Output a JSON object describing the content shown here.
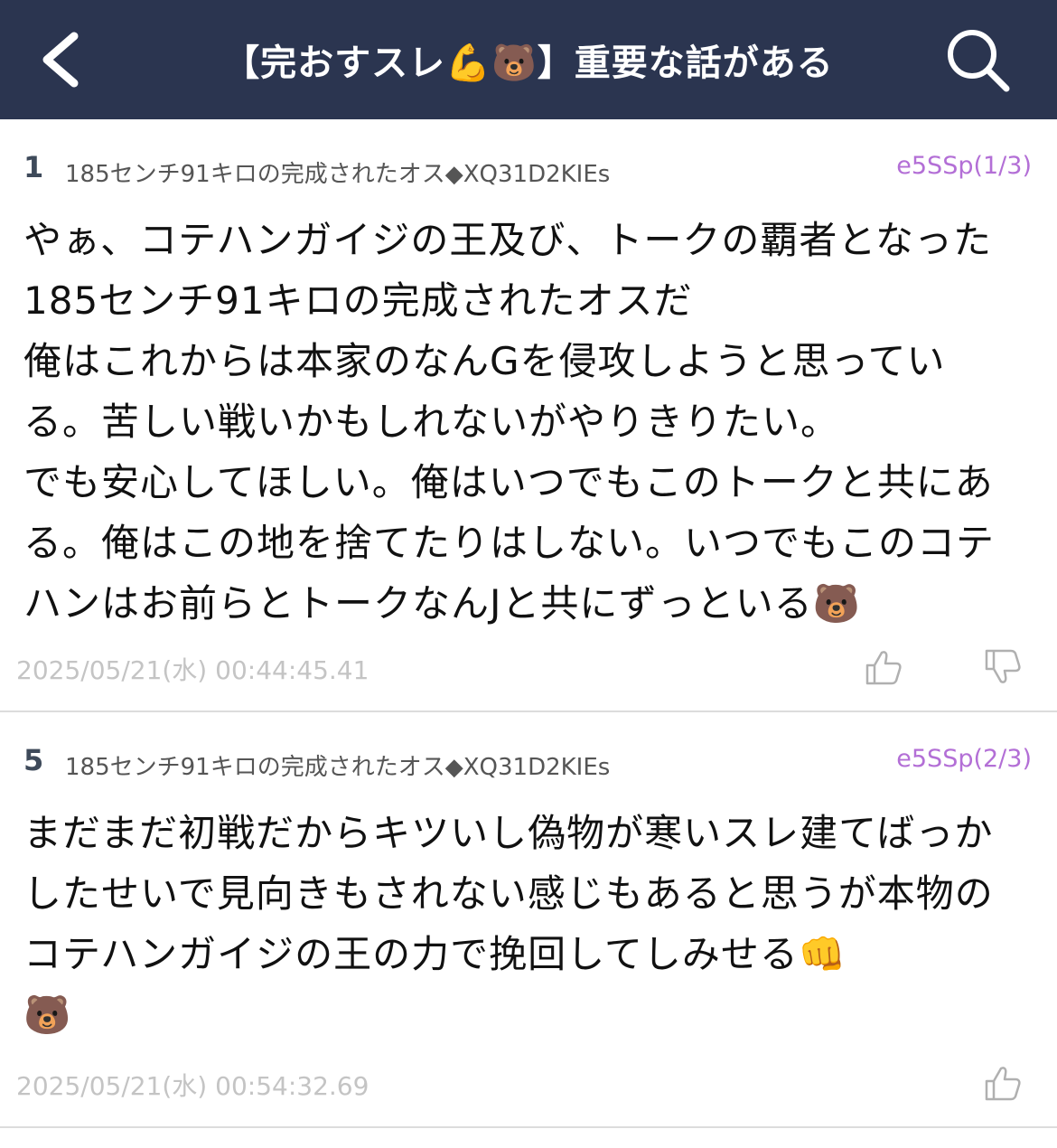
{
  "header": {
    "title": "【完おすスレ💪🐻】重要な話がある",
    "back_icon": "chevron-left-icon",
    "search_icon": "search-icon",
    "background_color": "#2b3550"
  },
  "posts": [
    {
      "number": "1",
      "name": "185センチ91キロの完成されたオス◆XQ31D2KIEs",
      "id": "e5SSp(1/3)",
      "body": "やぁ、コテハンガイジの王及び、トークの覇者となった185センチ91キロの完成されたオスだ\n俺はこれからは本家のなんGを侵攻しようと思っている。苦しい戦いかもしれないがやりきりたい。\nでも安心してほしい。俺はいつでもこのトークと共にある。俺はこの地を捨てたりはしない。いつでもこのコテハンはお前らとトークなんJと共にずっといる🐻",
      "date": "2025/05/21(水) 00:44:45.41",
      "votes": [
        "thumbs-up-icon",
        "thumbs-down-icon"
      ]
    },
    {
      "number": "5",
      "name": "185センチ91キロの完成されたオス◆XQ31D2KIEs",
      "id": "e5SSp(2/3)",
      "body": "まだまだ初戦だからキツいし偽物が寒いスレ建てばっかしたせいで見向きもされない感じもあると思うが本物のコテハンガイジの王の力で挽回してしみせる👊\n🐻",
      "date": "2025/05/21(水) 00:54:32.69",
      "votes": [
        "thumbs-up-icon"
      ]
    }
  ],
  "colors": {
    "id_text": "#b36fd6",
    "date_text": "#c4c4c4",
    "divider": "#dcdcdc"
  }
}
